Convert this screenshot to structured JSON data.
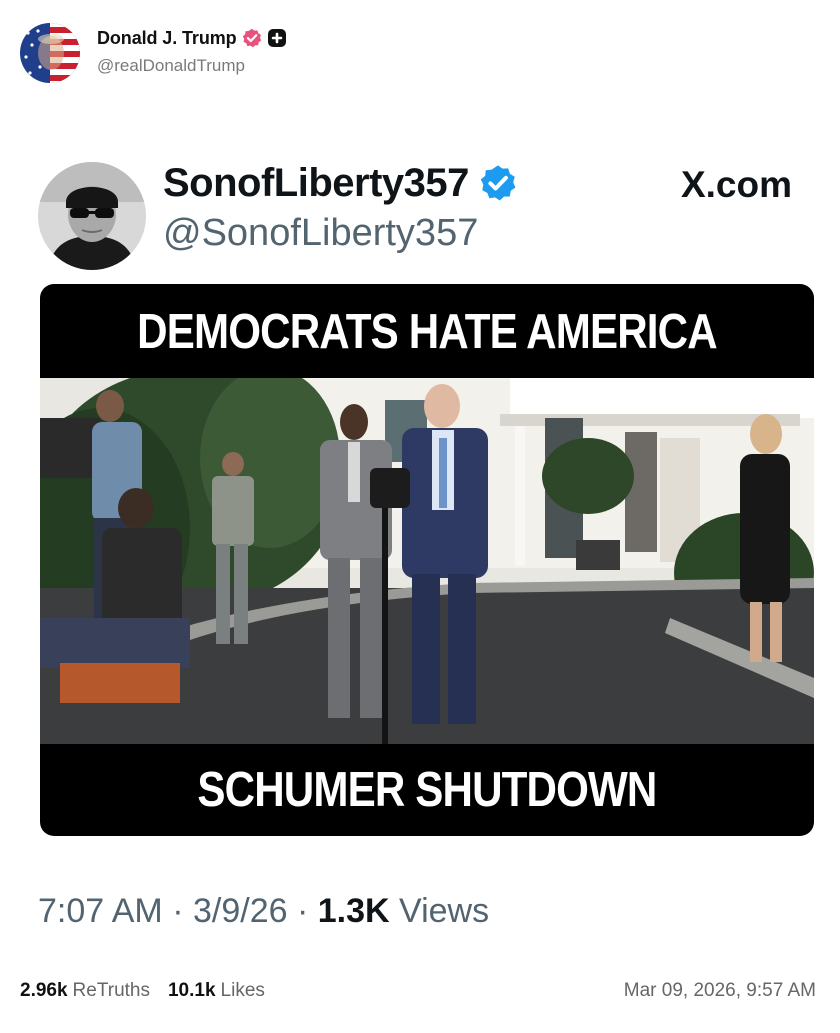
{
  "post": {
    "author_name": "Donald J. Trump",
    "author_handle": "@realDonaldTrump",
    "avatar_icon": "flag-portrait-avatar",
    "badges": [
      "verified-badge-icon",
      "plus-badge-icon"
    ]
  },
  "embed": {
    "author_name": "SonofLiberty357",
    "author_handle": "@SonofLiberty357",
    "site_label": "X.com",
    "meme": {
      "top_caption": "DEMOCRATS HATE AMERICA",
      "bottom_caption": "SCHUMER SHUTDOWN"
    },
    "meta": {
      "time": "7:07 AM",
      "separator": "·",
      "date": "3/9/26",
      "views_count": "1.3K",
      "views_label": "Views"
    }
  },
  "footer": {
    "retruths_count": "2.96k",
    "retruths_label": "ReTruths",
    "likes_count": "10.1k",
    "likes_label": "Likes",
    "timestamp": "Mar 09, 2026, 9:57 AM"
  },
  "colors": {
    "verified_pink": "#e8527c",
    "verified_blue": "#1d9bf0",
    "meme_background": "#000000"
  }
}
